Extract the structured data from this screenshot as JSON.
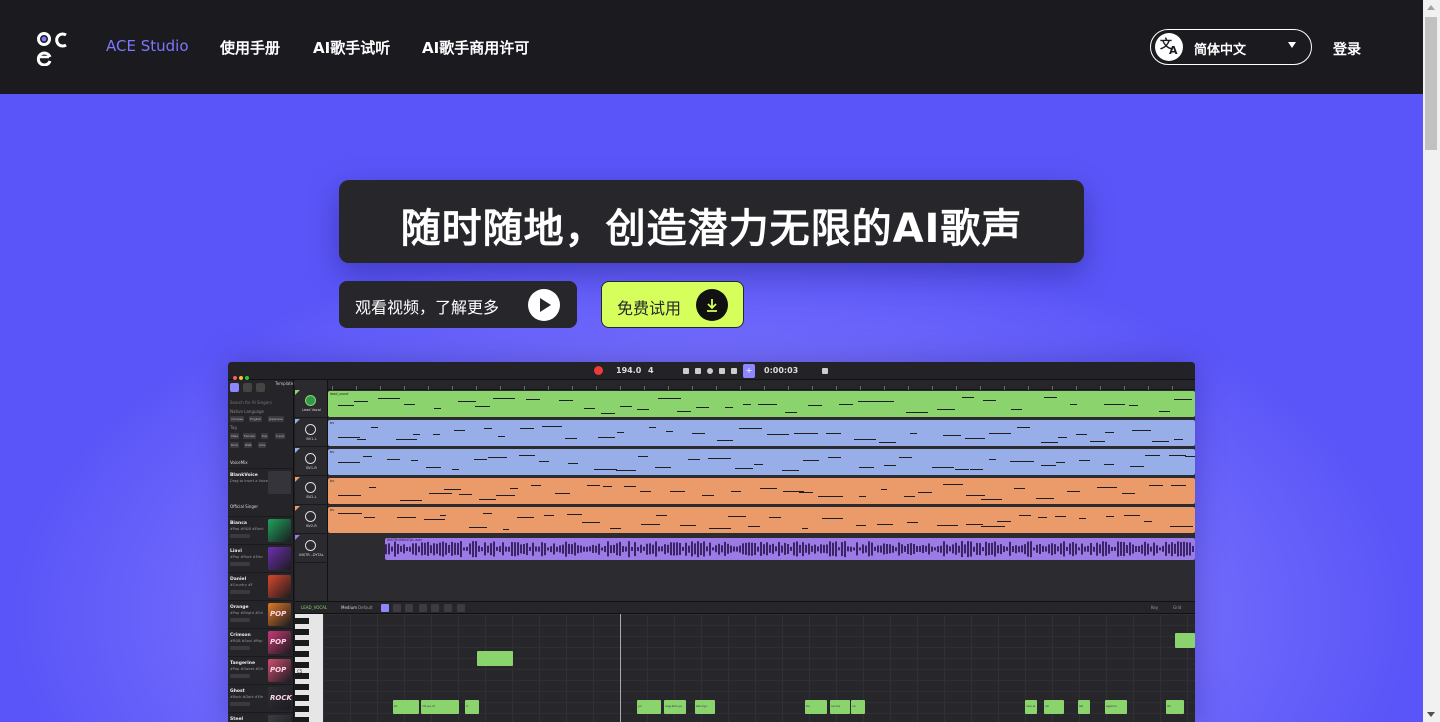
{
  "nav": {
    "logo_text": "ace",
    "links": [
      {
        "label": "ACE Studio",
        "active": true
      },
      {
        "label": "使用手册"
      },
      {
        "label": "AI歌手试听"
      },
      {
        "label": "AI歌手商用许可"
      }
    ],
    "language": {
      "glyph_cn": "文",
      "glyph_en": "A",
      "label": "简体中文"
    },
    "login": "登录"
  },
  "hero": {
    "headline": "随时随地，创造潜力无限的AI歌声",
    "watch_button": "观看视频，了解更多",
    "try_button": "免费试用"
  },
  "app": {
    "tempo": "194.0",
    "time_signature": "4",
    "time": "0:00:03",
    "project": "Template Project",
    "search_placeholder": "Search for AI Singers",
    "filter_language": "Native Language",
    "language_chips": [
      "Chinese",
      "English",
      "Japanese"
    ],
    "tag_caption": "Tag",
    "tag_chips": [
      "Male",
      "Female",
      "Pop",
      "K-pop",
      "Rock",
      "R&B",
      "ACG"
    ],
    "voicemix_header": "VoiceMix",
    "voicemix_item": {
      "name": "BlankVoice",
      "sub": "Drag to insert a VoiceMix"
    },
    "official_header": "Official Singer",
    "singers": [
      {
        "name": "Bianca",
        "sub": "#Pop #R&B #Elect",
        "art": "",
        "color": "#1fa35a"
      },
      {
        "name": "Liavi",
        "sub": "#Pop #Rock #Elec",
        "art": "",
        "color": "#6e2fb0"
      },
      {
        "name": "Daniel",
        "sub": "#Country #F",
        "art": "",
        "color": "#d9472c"
      },
      {
        "name": "Orange",
        "sub": "#Pop #Bright #Gir",
        "art": "POP",
        "color": "#e07a26"
      },
      {
        "name": "Crimson",
        "sub": "#R&B #Soul #Pop",
        "art": "POP",
        "color": "#c63a74"
      },
      {
        "name": "Tangerine",
        "sub": "#Pop #Sweet #Gir",
        "art": "POP",
        "color": "#cf4e6f"
      },
      {
        "name": "Ghost",
        "sub": "#Rock #Dark #Ele",
        "art": "ROCK",
        "color": "#2f2f36"
      },
      {
        "name": "Steel",
        "sub": "#Rock #Pop #Pow",
        "art": "ROCK",
        "color": "#3c3c44"
      }
    ],
    "tracks": [
      {
        "label": "Lead Vocal",
        "clip": "lead_vocal",
        "color": "#8bd36d",
        "corner": "#8bd36d"
      },
      {
        "label": "BV1-L",
        "clip": "bv",
        "color": "#97aee8",
        "corner": "#97aee8"
      },
      {
        "label": "BV1-R",
        "clip": "bv",
        "color": "#97aee8",
        "corner": "#97aee8"
      },
      {
        "label": "BV2-L",
        "clip": "bv",
        "color": "#eb9a6a",
        "corner": "#eb9a6a"
      },
      {
        "label": "BV2-R",
        "clip": "bv",
        "color": "#eb9a6a",
        "corner": "#eb9a6a"
      },
      {
        "label": "INSTR...DYTAL",
        "clip": "INSTRUMENTAL.wav",
        "color": "#9c7be6",
        "corner": "#9c7be6"
      }
    ],
    "editor": {
      "track_name": "LEAD_VOCAL",
      "mode_label": "Medium",
      "mode_value": "Default",
      "right_a": "Key",
      "right_b": "Grid",
      "pitch_label": "C5"
    },
    "notes": [
      {
        "text": "ko"
      },
      {
        "text": "chi-yo-id"
      },
      {
        "text": "ri"
      },
      {
        "text": "yo"
      },
      {
        "text": "nag-kimi-ju"
      },
      {
        "text": "kan-tyo"
      },
      {
        "text": "bo"
      },
      {
        "text": "ra-ma"
      },
      {
        "text": "ca"
      },
      {
        "text": "nan-w"
      },
      {
        "text": "na"
      },
      {
        "text": "lat"
      },
      {
        "text": "agni-tu"
      },
      {
        "text": "do"
      }
    ]
  }
}
